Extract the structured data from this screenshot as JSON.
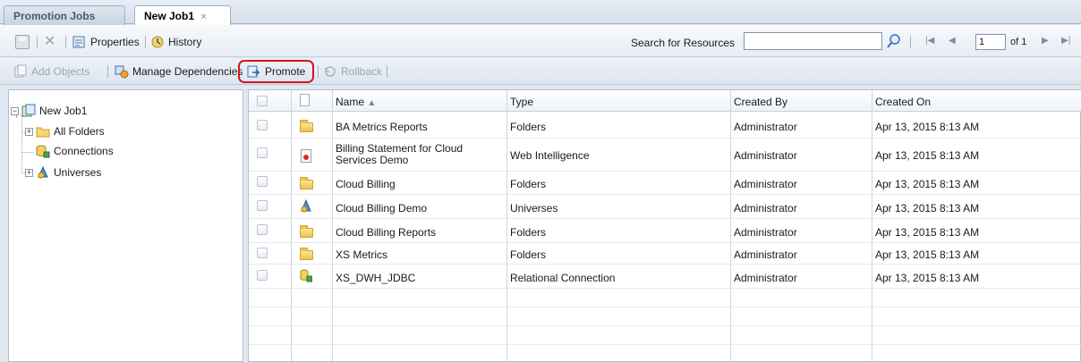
{
  "tabs": [
    {
      "label": "Promotion Jobs",
      "active": false
    },
    {
      "label": "New Job1",
      "active": true,
      "close": "×"
    }
  ],
  "toolbar1": {
    "properties": "Properties",
    "history": "History",
    "search_label": "Search for Resources",
    "search_value": "",
    "page_value": "1",
    "page_of": "of 1"
  },
  "toolbar2": {
    "add_objects": "Add Objects",
    "manage_dependencies": "Manage Dependencies",
    "promote": "Promote",
    "rollback": "Rollback"
  },
  "tree": {
    "root": "New Job1",
    "children": [
      {
        "label": "All Folders",
        "icon": "folder-icon",
        "expandable": true
      },
      {
        "label": "Connections",
        "icon": "connection-icon",
        "expandable": false
      },
      {
        "label": "Universes",
        "icon": "universe-icon",
        "expandable": true
      }
    ]
  },
  "grid": {
    "columns": [
      "Name",
      "Type",
      "Created By",
      "Created On"
    ],
    "sort_indicator": "▲",
    "rows": [
      {
        "icon": "folder-icon",
        "name": "BA Metrics Reports",
        "type": "Folders",
        "created_by": "Administrator",
        "created_on": "Apr 13, 2015 8:13 AM"
      },
      {
        "icon": "webi-doc-icon",
        "name": "Billing Statement for Cloud Services Demo",
        "type": "Web Intelligence",
        "created_by": "Administrator",
        "created_on": "Apr 13, 2015 8:13 AM"
      },
      {
        "icon": "folder-icon",
        "name": "Cloud Billing",
        "type": "Folders",
        "created_by": "Administrator",
        "created_on": "Apr 13, 2015 8:13 AM"
      },
      {
        "icon": "universe-icon",
        "name": "Cloud Billing Demo",
        "type": "Universes",
        "created_by": "Administrator",
        "created_on": "Apr 13, 2015 8:13 AM"
      },
      {
        "icon": "folder-icon",
        "name": "Cloud Billing Reports",
        "type": "Folders",
        "created_by": "Administrator",
        "created_on": "Apr 13, 2015 8:13 AM"
      },
      {
        "icon": "folder-icon",
        "name": "XS Metrics",
        "type": "Folders",
        "created_by": "Administrator",
        "created_on": "Apr 13, 2015 8:13 AM"
      },
      {
        "icon": "connection-icon",
        "name": "XS_DWH_JDBC",
        "type": "Relational Connection",
        "created_by": "Administrator",
        "created_on": "Apr 13, 2015 8:13 AM"
      }
    ]
  },
  "colors": {
    "highlight": "#d9141a",
    "accent": "#5b7fb2"
  }
}
